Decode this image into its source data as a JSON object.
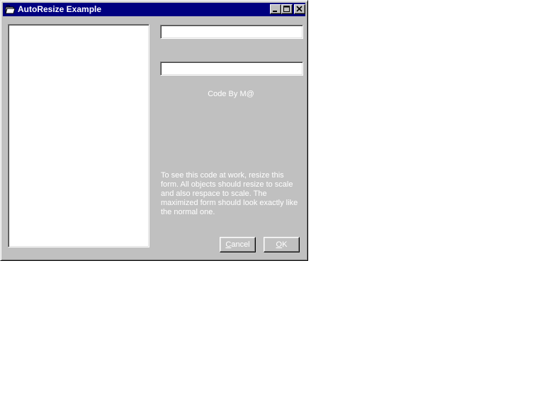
{
  "window": {
    "title": "AutoResize Example",
    "icon": "folder-icon",
    "controls": [
      "minimize-icon",
      "maximize-icon",
      "close-icon"
    ]
  },
  "form": {
    "list_items": [],
    "text1": {
      "value": "",
      "placeholder": ""
    },
    "text2": {
      "value": "",
      "placeholder": ""
    },
    "credit": "Code By M@",
    "info": "To see this code at work, resize this form. All objects should resize to scale and also respace to scale. The maximized form should look exactly like the normal one.",
    "cancel": {
      "accel": "C",
      "rest": "ancel"
    },
    "ok": {
      "accel": "O",
      "rest": "K"
    }
  },
  "colors": {
    "titlebar": "#000080",
    "face": "#c0c0c0",
    "text_light": "#ffffff"
  }
}
